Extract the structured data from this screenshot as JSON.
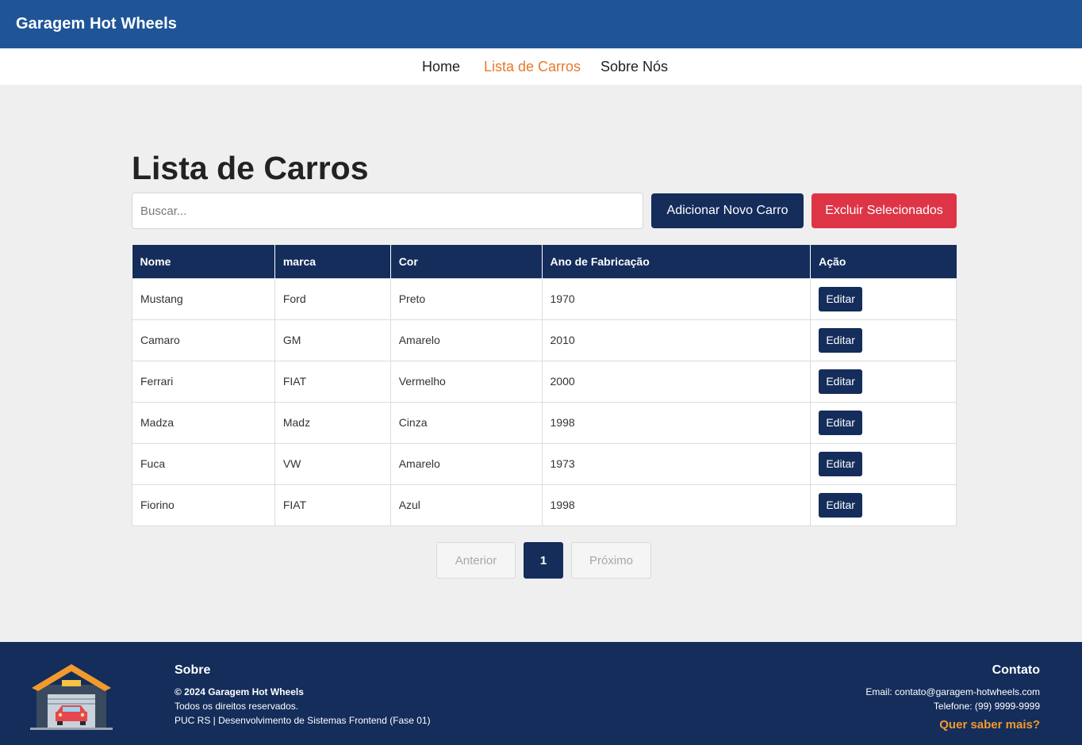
{
  "header": {
    "brand": "Garagem Hot Wheels"
  },
  "nav": {
    "items": [
      "Home",
      "Lista de Carros",
      "Sobre Nós"
    ],
    "active": "Lista de Carros"
  },
  "main": {
    "title": "Lista de Carros",
    "search_placeholder": "Buscar...",
    "add_button": "Adicionar Novo Carro",
    "delete_button": "Excluir Selecionados"
  },
  "table": {
    "columns": [
      "Nome",
      "marca",
      "Cor",
      "Ano de Fabricação",
      "Ação"
    ],
    "rows": [
      {
        "nome": "Mustang",
        "marca": "Ford",
        "cor": "Preto",
        "ano": "1970",
        "acao": "Editar"
      },
      {
        "nome": "Camaro",
        "marca": "GM",
        "cor": "Amarelo",
        "ano": "2010",
        "acao": "Editar"
      },
      {
        "nome": "Ferrari",
        "marca": "FIAT",
        "cor": "Vermelho",
        "ano": "2000",
        "acao": "Editar"
      },
      {
        "nome": "Madza",
        "marca": "Madz",
        "cor": "Cinza",
        "ano": "1998",
        "acao": "Editar"
      },
      {
        "nome": "Fuca",
        "marca": "VW",
        "cor": "Amarelo",
        "ano": "1973",
        "acao": "Editar"
      },
      {
        "nome": "Fiorino",
        "marca": "FIAT",
        "cor": "Azul",
        "ano": "1998",
        "acao": "Editar"
      }
    ]
  },
  "pagination": {
    "prev": "Anterior",
    "current": "1",
    "next": "Próximo"
  },
  "footer": {
    "about_title": "Sobre",
    "copyright": "© 2024 Garagem Hot Wheels",
    "rights": "Todos os direitos reservados.",
    "course": "PUC RS | Desenvolvimento de Sistemas Frontend (Fase 01)",
    "contact_title": "Contato",
    "email": "Email: contato@garagem-hotwheels.com",
    "phone": "Telefone: (99) 9999-9999",
    "more": "Quer saber mais?",
    "logo_icon": "garage-icon"
  },
  "colors": {
    "header_blue": "#1f5597",
    "navy": "#142d5b",
    "accent_orange": "#e8782b",
    "danger_red": "#de3546",
    "page_bg": "#efefef"
  }
}
